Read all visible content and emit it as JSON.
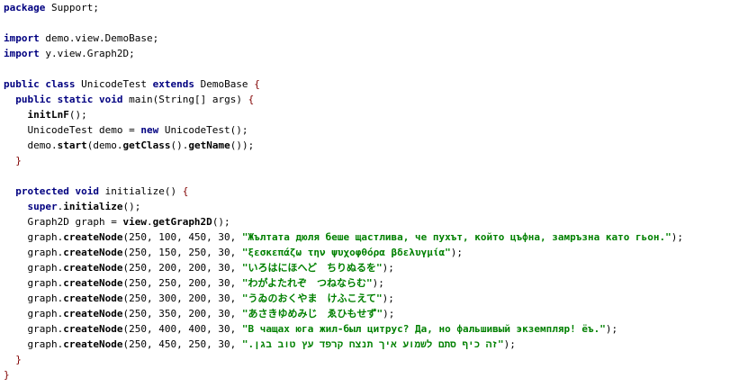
{
  "editor": {
    "language": "java",
    "colors": {
      "keyword": "#000080",
      "string": "#008000",
      "brace": "#800000",
      "text": "#000000"
    },
    "lines": [
      [
        {
          "t": "package",
          "c": "kw"
        },
        {
          "t": " Support;",
          "c": "plain"
        }
      ],
      [],
      [
        {
          "t": "import",
          "c": "kw"
        },
        {
          "t": " demo.view.DemoBase;",
          "c": "plain"
        }
      ],
      [
        {
          "t": "import",
          "c": "kw"
        },
        {
          "t": " y.view.Graph2D;",
          "c": "plain"
        }
      ],
      [],
      [
        {
          "t": "public",
          "c": "kw"
        },
        {
          "t": " ",
          "c": "plain"
        },
        {
          "t": "class",
          "c": "kw"
        },
        {
          "t": " UnicodeTest ",
          "c": "plain"
        },
        {
          "t": "extends",
          "c": "kw"
        },
        {
          "t": " DemoBase ",
          "c": "plain"
        },
        {
          "t": "{",
          "c": "brace"
        }
      ],
      [
        {
          "t": "  ",
          "c": "plain"
        },
        {
          "t": "public",
          "c": "kw"
        },
        {
          "t": " ",
          "c": "plain"
        },
        {
          "t": "static",
          "c": "kw"
        },
        {
          "t": " ",
          "c": "plain"
        },
        {
          "t": "void",
          "c": "kw"
        },
        {
          "t": " main(String[] args) ",
          "c": "plain"
        },
        {
          "t": "{",
          "c": "brace"
        }
      ],
      [
        {
          "t": "    ",
          "c": "plain"
        },
        {
          "t": "initLnF",
          "c": "meth"
        },
        {
          "t": "();",
          "c": "plain"
        }
      ],
      [
        {
          "t": "    UnicodeTest demo = ",
          "c": "plain"
        },
        {
          "t": "new",
          "c": "kw"
        },
        {
          "t": " UnicodeTest();",
          "c": "plain"
        }
      ],
      [
        {
          "t": "    demo.",
          "c": "plain"
        },
        {
          "t": "start",
          "c": "meth"
        },
        {
          "t": "(demo.",
          "c": "plain"
        },
        {
          "t": "getClass",
          "c": "meth"
        },
        {
          "t": "().",
          "c": "plain"
        },
        {
          "t": "getName",
          "c": "meth"
        },
        {
          "t": "());",
          "c": "plain"
        }
      ],
      [
        {
          "t": "  ",
          "c": "plain"
        },
        {
          "t": "}",
          "c": "brace"
        }
      ],
      [],
      [
        {
          "t": "  ",
          "c": "plain"
        },
        {
          "t": "protected",
          "c": "kw"
        },
        {
          "t": " ",
          "c": "plain"
        },
        {
          "t": "void",
          "c": "kw"
        },
        {
          "t": " initialize() ",
          "c": "plain"
        },
        {
          "t": "{",
          "c": "brace"
        }
      ],
      [
        {
          "t": "    ",
          "c": "plain"
        },
        {
          "t": "super",
          "c": "kw"
        },
        {
          "t": ".",
          "c": "plain"
        },
        {
          "t": "initialize",
          "c": "meth"
        },
        {
          "t": "();",
          "c": "plain"
        }
      ],
      [
        {
          "t": "    Graph2D graph = ",
          "c": "plain"
        },
        {
          "t": "view",
          "c": "meth"
        },
        {
          "t": ".",
          "c": "plain"
        },
        {
          "t": "getGraph2D",
          "c": "meth"
        },
        {
          "t": "();",
          "c": "plain"
        }
      ],
      [
        {
          "t": "    graph.",
          "c": "plain"
        },
        {
          "t": "createNode",
          "c": "meth"
        },
        {
          "t": "(250, 100, 450, 30, ",
          "c": "plain"
        },
        {
          "t": "\"Жълтата дюля беше щастлива, че пухът, който цъфна, замръзна като гьон.\"",
          "c": "str"
        },
        {
          "t": ");",
          "c": "plain"
        }
      ],
      [
        {
          "t": "    graph.",
          "c": "plain"
        },
        {
          "t": "createNode",
          "c": "meth"
        },
        {
          "t": "(250, 150, 250, 30, ",
          "c": "plain"
        },
        {
          "t": "\"ξεσκεπάζω την ψυχοφθόρα βδελυγμία\"",
          "c": "str"
        },
        {
          "t": ");",
          "c": "plain"
        }
      ],
      [
        {
          "t": "    graph.",
          "c": "plain"
        },
        {
          "t": "createNode",
          "c": "meth"
        },
        {
          "t": "(250, 200, 200, 30, ",
          "c": "plain"
        },
        {
          "t": "\"いろはにほへど　ちりぬるを\"",
          "c": "str"
        },
        {
          "t": ");",
          "c": "plain"
        }
      ],
      [
        {
          "t": "    graph.",
          "c": "plain"
        },
        {
          "t": "createNode",
          "c": "meth"
        },
        {
          "t": "(250, 250, 200, 30, ",
          "c": "plain"
        },
        {
          "t": "\"わがよたれぞ　つねならむ\"",
          "c": "str"
        },
        {
          "t": ");",
          "c": "plain"
        }
      ],
      [
        {
          "t": "    graph.",
          "c": "plain"
        },
        {
          "t": "createNode",
          "c": "meth"
        },
        {
          "t": "(250, 300, 200, 30, ",
          "c": "plain"
        },
        {
          "t": "\"うゐのおくやま　けふこえて\"",
          "c": "str"
        },
        {
          "t": ");",
          "c": "plain"
        }
      ],
      [
        {
          "t": "    graph.",
          "c": "plain"
        },
        {
          "t": "createNode",
          "c": "meth"
        },
        {
          "t": "(250, 350, 200, 30, ",
          "c": "plain"
        },
        {
          "t": "\"あさきゆめみじ　ゑひもせず\"",
          "c": "str"
        },
        {
          "t": ");",
          "c": "plain"
        }
      ],
      [
        {
          "t": "    graph.",
          "c": "plain"
        },
        {
          "t": "createNode",
          "c": "meth"
        },
        {
          "t": "(250, 400, 400, 30, ",
          "c": "plain"
        },
        {
          "t": "\"В чащах юга жил-был цитрус? Да, но фальшивый экземпляр! ёъ.\"",
          "c": "str"
        },
        {
          "t": ");",
          "c": "plain"
        }
      ],
      [
        {
          "t": "    graph.",
          "c": "plain"
        },
        {
          "t": "createNode",
          "c": "meth"
        },
        {
          "t": "(250, 450, 250, 30, ",
          "c": "plain"
        },
        {
          "t": "\".זה כיף סתם לשמוע איך תנצח קרפד עץ טוב בגן\"",
          "c": "str"
        },
        {
          "t": ");",
          "c": "plain"
        }
      ],
      [
        {
          "t": "  ",
          "c": "plain"
        },
        {
          "t": "}",
          "c": "brace"
        }
      ],
      [
        {
          "t": "}",
          "c": "brace"
        }
      ]
    ]
  }
}
